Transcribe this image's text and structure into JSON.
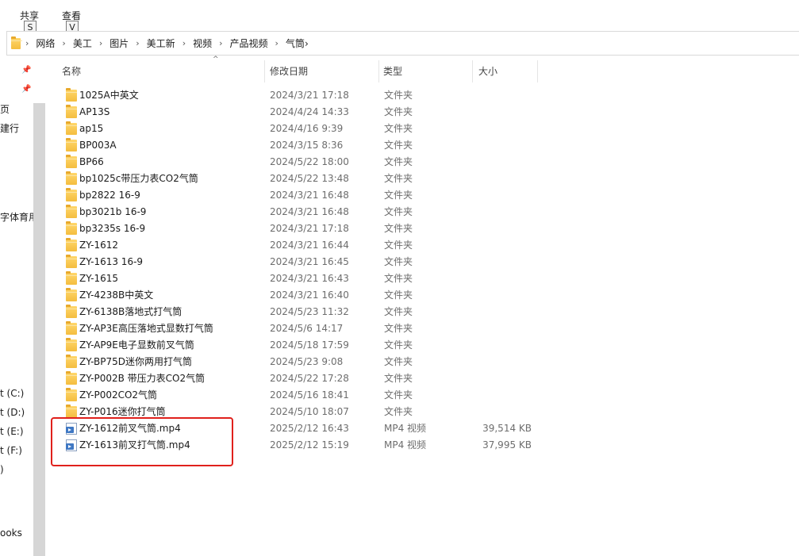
{
  "ribbon": {
    "share_label": "共享",
    "view_label": "查看",
    "share_keytip": "S",
    "view_keytip": "V"
  },
  "breadcrumb": [
    "网络",
    "美工",
    "图片",
    "美工新",
    "视频",
    "产品视频",
    "气筒"
  ],
  "nav": {
    "items": [
      {
        "label": "页"
      },
      {
        "label": "建行"
      },
      {
        "label": "字体育用"
      },
      {
        "label": "t (C:)"
      },
      {
        "label": "t (D:)"
      },
      {
        "label": "t (E:)"
      },
      {
        "label": "t (F:)"
      },
      {
        "label": ")"
      },
      {
        "label": "ooks"
      }
    ]
  },
  "columns": {
    "name": "名称",
    "date": "修改日期",
    "type": "类型",
    "size": "大小"
  },
  "files": [
    {
      "name": "1025A中英文",
      "date": "2024/3/21 17:18",
      "type": "文件夹",
      "size": "",
      "icon": "folder-icon"
    },
    {
      "name": "AP13S",
      "date": "2024/4/24 14:33",
      "type": "文件夹",
      "size": "",
      "icon": "folder-icon"
    },
    {
      "name": "ap15",
      "date": "2024/4/16 9:39",
      "type": "文件夹",
      "size": "",
      "icon": "folder-icon"
    },
    {
      "name": "BP003A",
      "date": "2024/3/15 8:36",
      "type": "文件夹",
      "size": "",
      "icon": "folder-icon"
    },
    {
      "name": "BP66",
      "date": "2024/5/22 18:00",
      "type": "文件夹",
      "size": "",
      "icon": "folder-icon"
    },
    {
      "name": "bp1025c带压力表CO2气筒",
      "date": "2024/5/22 13:48",
      "type": "文件夹",
      "size": "",
      "icon": "folder-icon"
    },
    {
      "name": "bp2822  16-9",
      "date": "2024/3/21 16:48",
      "type": "文件夹",
      "size": "",
      "icon": "folder-icon"
    },
    {
      "name": "bp3021b 16-9",
      "date": "2024/3/21 16:48",
      "type": "文件夹",
      "size": "",
      "icon": "folder-icon"
    },
    {
      "name": "bp3235s  16-9",
      "date": "2024/3/21 17:18",
      "type": "文件夹",
      "size": "",
      "icon": "folder-icon"
    },
    {
      "name": "ZY-1612",
      "date": "2024/3/21 16:44",
      "type": "文件夹",
      "size": "",
      "icon": "folder-icon"
    },
    {
      "name": "ZY-1613 16-9",
      "date": "2024/3/21 16:45",
      "type": "文件夹",
      "size": "",
      "icon": "folder-icon"
    },
    {
      "name": "ZY-1615",
      "date": "2024/3/21 16:43",
      "type": "文件夹",
      "size": "",
      "icon": "folder-icon"
    },
    {
      "name": "ZY-4238B中英文",
      "date": "2024/3/21 16:40",
      "type": "文件夹",
      "size": "",
      "icon": "folder-icon"
    },
    {
      "name": "ZY-6138B落地式打气筒",
      "date": "2024/5/23 11:32",
      "type": "文件夹",
      "size": "",
      "icon": "folder-icon"
    },
    {
      "name": "ZY-AP3E高压落地式显数打气筒",
      "date": "2024/5/6 14:17",
      "type": "文件夹",
      "size": "",
      "icon": "folder-icon"
    },
    {
      "name": "ZY-AP9E电子显数前叉气筒",
      "date": "2024/5/18 17:59",
      "type": "文件夹",
      "size": "",
      "icon": "folder-icon"
    },
    {
      "name": "ZY-BP75D迷你两用打气筒",
      "date": "2024/5/23 9:08",
      "type": "文件夹",
      "size": "",
      "icon": "folder-icon"
    },
    {
      "name": "ZY-P002B 带压力表CO2气筒",
      "date": "2024/5/22 17:28",
      "type": "文件夹",
      "size": "",
      "icon": "folder-icon"
    },
    {
      "name": "ZY-P002CO2气筒",
      "date": "2024/5/16 18:41",
      "type": "文件夹",
      "size": "",
      "icon": "folder-icon"
    },
    {
      "name": "ZY-P016迷你打气筒",
      "date": "2024/5/10 18:07",
      "type": "文件夹",
      "size": "",
      "icon": "folder-icon"
    },
    {
      "name": "ZY-1612前叉气筒.mp4",
      "date": "2025/2/12 16:43",
      "type": "MP4 视频",
      "size": "39,514 KB",
      "icon": "video-file-icon"
    },
    {
      "name": "ZY-1613前叉打气筒.mp4",
      "date": "2025/2/12 15:19",
      "type": "MP4 视频",
      "size": "37,995 KB",
      "icon": "video-file-icon"
    }
  ],
  "colors": {
    "highlight": "#e0211c",
    "folder": "#f4bd3f",
    "video": "#3f78c4"
  }
}
